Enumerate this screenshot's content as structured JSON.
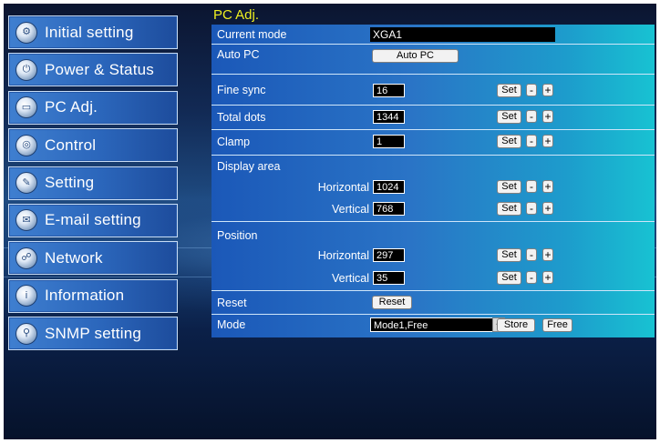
{
  "page_title": "PC Adj.",
  "sidebar": {
    "items": [
      {
        "label": "Initial setting",
        "icon": "gear-icon",
        "glyph": "⚙"
      },
      {
        "label": "Power & Status",
        "icon": "power-icon",
        "glyph": "⏻"
      },
      {
        "label": "PC Adj.",
        "icon": "monitor-icon",
        "glyph": "▭"
      },
      {
        "label": "Control",
        "icon": "control-icon",
        "glyph": "◎"
      },
      {
        "label": "Setting",
        "icon": "wrench-icon",
        "glyph": "✎"
      },
      {
        "label": "E-mail setting",
        "icon": "mail-icon",
        "glyph": "✉"
      },
      {
        "label": "Network",
        "icon": "network-icon",
        "glyph": "☍"
      },
      {
        "label": "Information",
        "icon": "info-icon",
        "glyph": "i"
      },
      {
        "label": "SNMP setting",
        "icon": "snmp-icon",
        "glyph": "⚲"
      }
    ]
  },
  "panel": {
    "current_mode": {
      "label": "Current mode",
      "value": "XGA1"
    },
    "auto_pc": {
      "label": "Auto PC",
      "button": "Auto PC"
    },
    "fine_sync": {
      "label": "Fine sync",
      "value": "16"
    },
    "total_dots": {
      "label": "Total dots",
      "value": "1344"
    },
    "clamp": {
      "label": "Clamp",
      "value": "1"
    },
    "display_area": {
      "label": "Display area",
      "horizontal_label": "Horizontal",
      "horizontal_value": "1024",
      "vertical_label": "Vertical",
      "vertical_value": "768"
    },
    "position": {
      "label": "Position",
      "horizontal_label": "Horizontal",
      "horizontal_value": "297",
      "vertical_label": "Vertical",
      "vertical_value": "35"
    },
    "reset": {
      "label": "Reset",
      "button": "Reset"
    },
    "mode": {
      "label": "Mode",
      "selected": "Mode1,Free",
      "store_button": "Store",
      "free_button": "Free"
    },
    "set_label": "Set",
    "minus_label": "-",
    "plus_label": "+"
  }
}
